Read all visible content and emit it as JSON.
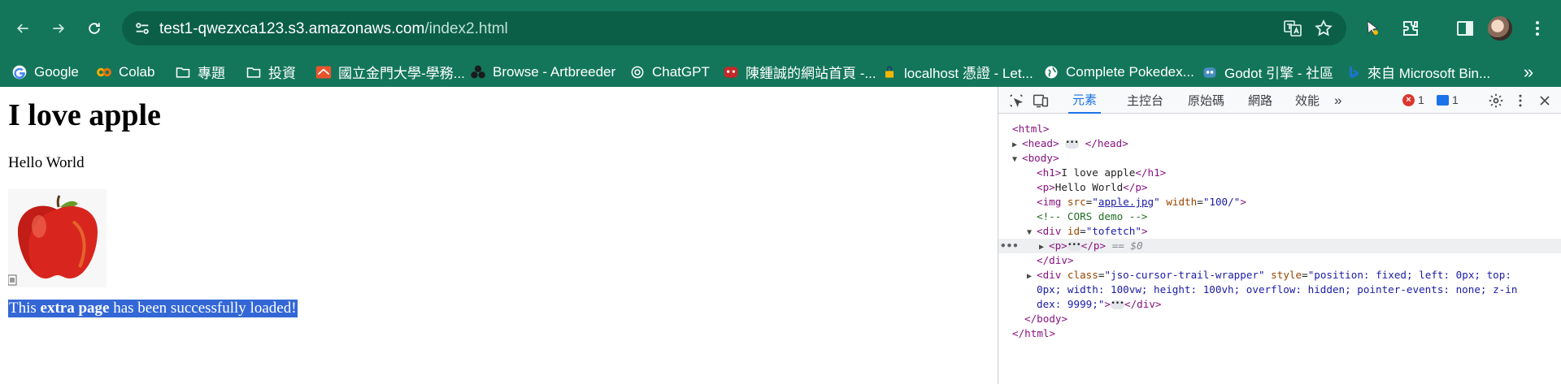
{
  "browser": {
    "url_host": "test1-qwezxca123.s3.amazonaws.com",
    "url_path": "/index2.html",
    "toolbar_icons": [
      "back-arrow-icon",
      "forward-arrow-icon",
      "reload-icon",
      "site-info-icon",
      "translate-icon",
      "star-icon",
      "extension-icon",
      "puzzle-icon",
      "side-panel-icon",
      "profile-avatar",
      "kebab-menu-icon"
    ],
    "theme_color": "#13765a"
  },
  "bookmarks": [
    {
      "label": "Google",
      "icon": "google-g-icon"
    },
    {
      "label": "Colab",
      "icon": "colab-icon"
    },
    {
      "label": "專題",
      "icon": "folder-icon"
    },
    {
      "label": "投資",
      "icon": "folder-icon"
    },
    {
      "label": "國立金門大學-學務...",
      "icon": "nqu-icon"
    },
    {
      "label": "Browse - Artbreeder",
      "icon": "artbreeder-icon"
    },
    {
      "label": "ChatGPT",
      "icon": "chatgpt-icon"
    },
    {
      "label": "陳鍾誠的網站首頁 -...",
      "icon": "red-site-icon"
    },
    {
      "label": "localhost 憑證 - Let...",
      "icon": "letsencrypt-icon"
    },
    {
      "label": "Complete Pokedex...",
      "icon": "globe-icon"
    },
    {
      "label": "Godot 引擎 - 社區",
      "icon": "godot-icon"
    },
    {
      "label": "來自 Microsoft Bin...",
      "icon": "bing-icon"
    }
  ],
  "page": {
    "heading": "I love apple",
    "paragraph": "Hello World",
    "success_prefix": "This ",
    "success_bold": "extra page",
    "success_suffix": " has been successfully loaded!"
  },
  "devtools": {
    "tabs": [
      "元素",
      "主控台",
      "原始碼",
      "網路",
      "效能"
    ],
    "active_tab": "元素",
    "error_count": "1",
    "message_count": "1",
    "dom": {
      "html_open": "<html>",
      "head": "head",
      "body": "body",
      "h1_text": "I love apple",
      "p_text": "Hello World",
      "img_src": "apple.jpg",
      "img_width": "\"100/\"",
      "comment": "<!-- CORS demo -->",
      "div_id": "\"tofetch\"",
      "selected_marker": "== $0",
      "wrapper_class": "\"jso-cursor-trail-wrapper\"",
      "wrapper_style_1": "\"position: fixed; left: 0px; top:",
      "wrapper_style_2": "0px; width: 100vw; height: 100vh; overflow: hidden; pointer-events: none; z-in",
      "wrapper_style_3": "dex: 9999;\""
    }
  }
}
